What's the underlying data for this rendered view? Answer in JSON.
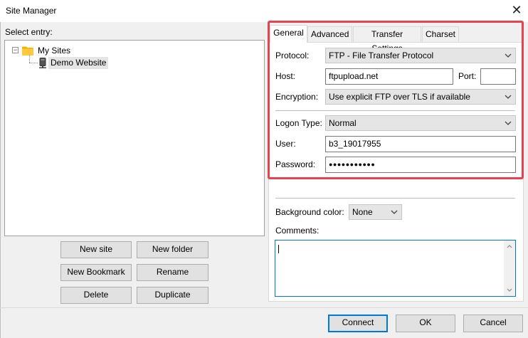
{
  "window": {
    "title": "Site Manager",
    "close_glyph": "✕"
  },
  "left": {
    "select_entry_label": "Select entry:",
    "tree": {
      "root": {
        "label": "My Sites",
        "expander": "−",
        "icon": "folder-icon"
      },
      "children": [
        {
          "label": "Demo Website",
          "icon": "server-icon"
        }
      ]
    },
    "buttons": {
      "new_site": "New site",
      "new_folder": "New folder",
      "new_bookmark": "New Bookmark",
      "rename": "Rename",
      "delete": "Delete",
      "duplicate": "Duplicate"
    }
  },
  "right": {
    "tabs": [
      "General",
      "Advanced",
      "Transfer Settings",
      "Charset"
    ],
    "active_tab": "General",
    "protocol": {
      "label": "Protocol:",
      "value": "FTP - File Transfer Protocol"
    },
    "host": {
      "label": "Host:",
      "value": "ftpupload.net"
    },
    "port": {
      "label": "Port:",
      "value": ""
    },
    "encryption": {
      "label": "Encryption:",
      "value": "Use explicit FTP over TLS if available"
    },
    "logon_type": {
      "label": "Logon Type:",
      "value": "Normal"
    },
    "user": {
      "label": "User:",
      "value": "b3_19017955"
    },
    "password": {
      "label": "Password:",
      "value": "●●●●●●●●●●●"
    },
    "background_color": {
      "label": "Background color:",
      "value": "None"
    },
    "comments": {
      "label": "Comments:",
      "value": ""
    },
    "highlight_color": "#e4434f"
  },
  "footer": {
    "connect": "Connect",
    "ok": "OK",
    "cancel": "Cancel"
  }
}
